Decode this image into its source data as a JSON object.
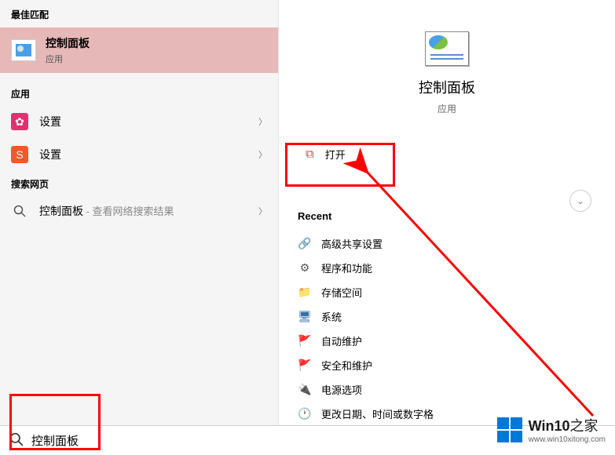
{
  "left": {
    "best_match_header": "最佳匹配",
    "best_match": {
      "title": "控制面板",
      "subtitle": "应用"
    },
    "apps_header": "应用",
    "apps": [
      {
        "label": "设置",
        "icon": "gear-pink"
      },
      {
        "label": "设置",
        "icon": "gear-orange"
      }
    ],
    "web_header": "搜索网页",
    "web_item": {
      "label": "控制面板",
      "hint": " - 查看网络搜索结果"
    }
  },
  "right": {
    "title": "控制面板",
    "subtitle": "应用",
    "open_label": "打开",
    "recent_header": "Recent",
    "recent": [
      {
        "label": "高级共享设置",
        "iconColor": "#3a9e3a",
        "glyph": "🔗"
      },
      {
        "label": "程序和功能",
        "iconColor": "#555",
        "glyph": "⚙"
      },
      {
        "label": "存储空间",
        "iconColor": "#f5c542",
        "glyph": "📁"
      },
      {
        "label": "系统",
        "iconColor": "#3a6ea5",
        "glyph": "🖥"
      },
      {
        "label": "自动维护",
        "iconColor": "#3a6ea5",
        "glyph": "🚩"
      },
      {
        "label": "安全和维护",
        "iconColor": "#3a6ea5",
        "glyph": "🚩"
      },
      {
        "label": "电源选项",
        "iconColor": "#4caf50",
        "glyph": "🔌"
      },
      {
        "label": "更改日期、时间或数字格",
        "iconColor": "#3a6ea5",
        "glyph": "🕐"
      }
    ]
  },
  "search": {
    "value": "控制面板"
  },
  "watermark": {
    "brand": "Win10",
    "suffix": "之家",
    "url": "www.win10xitong.com"
  }
}
